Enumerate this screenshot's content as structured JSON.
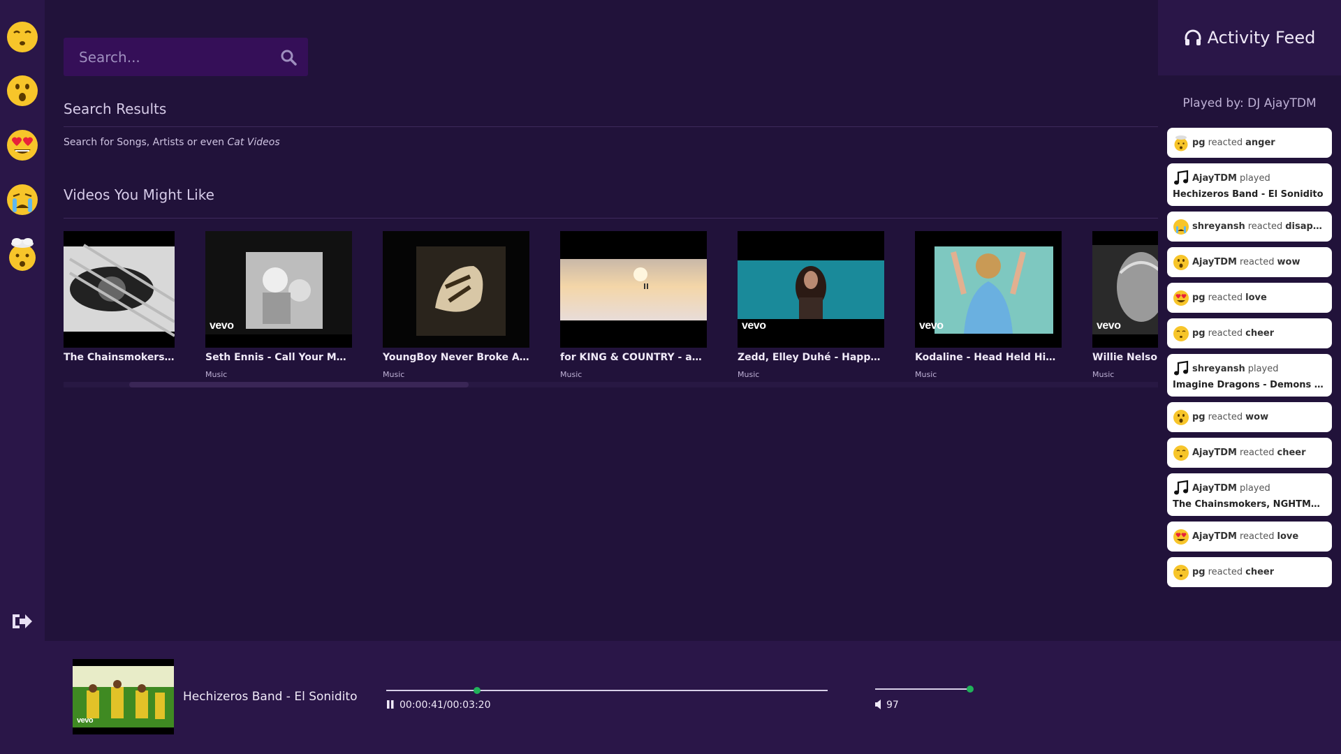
{
  "sidebar": {
    "reactions": [
      {
        "icon": "cheer-emoji-icon"
      },
      {
        "icon": "wow-emoji-icon"
      },
      {
        "icon": "love-emoji-icon"
      },
      {
        "icon": "disappointed-emoji-icon"
      },
      {
        "icon": "anger-emoji-icon"
      }
    ],
    "logout_icon": "logout-icon"
  },
  "search": {
    "placeholder": "Search...",
    "results_title": "Search Results",
    "hint_prefix": "Search for Songs, Artists or even ",
    "hint_emphasis": "Cat Videos"
  },
  "recommended": {
    "title": "Videos You Might Like",
    "videos": [
      {
        "title": "The Chainsmokers, NGHTMRE ...",
        "category": "",
        "vevo": false
      },
      {
        "title": "Seth Ennis - Call Your Mama (...",
        "category": "Music",
        "vevo": true
      },
      {
        "title": "YoungBoy Never Broke Again ...",
        "category": "Music",
        "vevo": false
      },
      {
        "title": "for KING & COUNTRY - amen (...",
        "category": "Music",
        "vevo": false
      },
      {
        "title": "Zedd, Elley Duhé - Happy No...",
        "category": "Music",
        "vevo": true
      },
      {
        "title": "Kodaline - Head Held High (Of...",
        "category": "Music",
        "vevo": true
      },
      {
        "title": "Willie Nelson - ...",
        "category": "Music",
        "vevo": true
      }
    ],
    "vevo_label": "vevo"
  },
  "feed": {
    "title": "Activity Feed",
    "played_by": "Played by: DJ AjayTDM",
    "items": [
      {
        "user": "pg",
        "verb": "reacted",
        "object": "anger",
        "icon": "anger"
      },
      {
        "user": "AjayTDM",
        "verb": "played",
        "song": "Hechizeros Band - El Sonidito",
        "icon": "note"
      },
      {
        "user": "shreyansh",
        "verb": "reacted",
        "object": "disappoi...",
        "icon": "disappointed"
      },
      {
        "user": "AjayTDM",
        "verb": "reacted",
        "object": "wow",
        "icon": "wow"
      },
      {
        "user": "pg",
        "verb": "reacted",
        "object": "love",
        "icon": "love"
      },
      {
        "user": "pg",
        "verb": "reacted",
        "object": "cheer",
        "icon": "cheer"
      },
      {
        "user": "shreyansh",
        "verb": "played",
        "song": "Imagine Dragons - Demons (Of...",
        "icon": "note"
      },
      {
        "user": "pg",
        "verb": "reacted",
        "object": "wow",
        "icon": "wow"
      },
      {
        "user": "AjayTDM",
        "verb": "reacted",
        "object": "cheer",
        "icon": "cheer"
      },
      {
        "user": "AjayTDM",
        "verb": "played",
        "song": "The Chainsmokers, NGHTMRE -...",
        "icon": "note"
      },
      {
        "user": "AjayTDM",
        "verb": "reacted",
        "object": "love",
        "icon": "love"
      },
      {
        "user": "pg",
        "verb": "reacted",
        "object": "cheer",
        "icon": "cheer"
      }
    ]
  },
  "player": {
    "now_playing": "Hechizeros Band - El Sonidito",
    "time": "00:00:41/00:03:20",
    "progress_fraction": 0.205,
    "volume": "97",
    "volume_fraction": 0.97,
    "accent": "#21b25a"
  },
  "colors": {
    "background": "#21123a",
    "panel": "#2a1648",
    "search_bg": "#350f58"
  }
}
